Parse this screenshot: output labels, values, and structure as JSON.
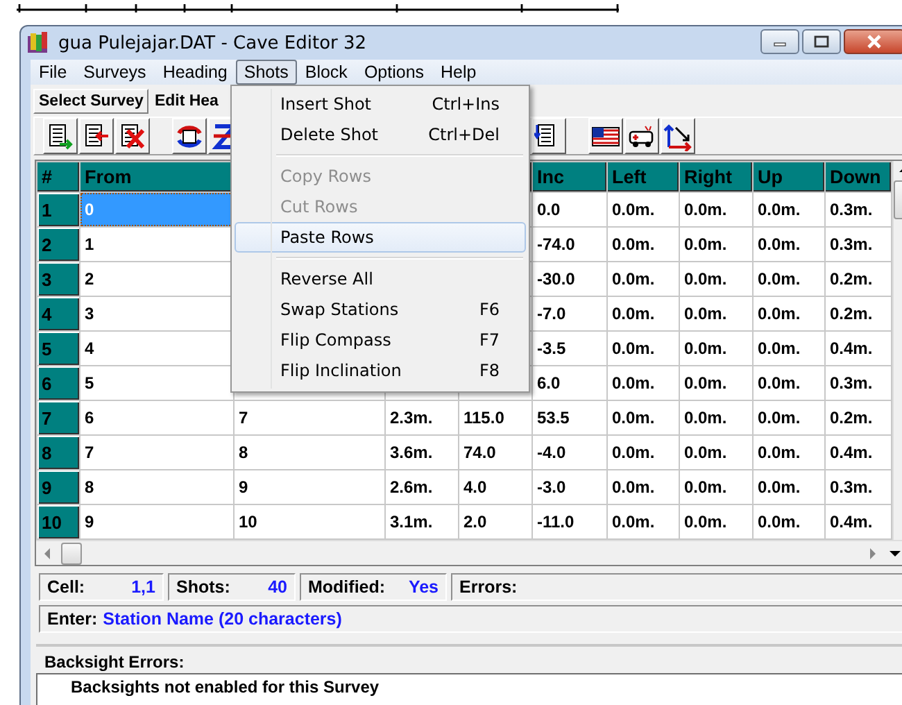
{
  "window": {
    "title": "gua Pulejajar.DAT - Cave Editor 32"
  },
  "menu_bar": [
    {
      "label": "File",
      "selected": false
    },
    {
      "label": "Surveys",
      "selected": false
    },
    {
      "label": "Heading",
      "selected": false
    },
    {
      "label": "Shots",
      "selected": true
    },
    {
      "label": "Block",
      "selected": false
    },
    {
      "label": "Options",
      "selected": false
    },
    {
      "label": "Help",
      "selected": false
    }
  ],
  "shots_menu": [
    {
      "kind": "item",
      "label": "Insert Shot",
      "shortcut": "Ctrl+Ins",
      "disabled": false,
      "selected": false
    },
    {
      "kind": "item",
      "label": "Delete Shot",
      "shortcut": "Ctrl+Del",
      "disabled": false,
      "selected": false
    },
    {
      "kind": "separator"
    },
    {
      "kind": "item",
      "label": "Copy Rows",
      "disabled": true,
      "selected": false
    },
    {
      "kind": "item",
      "label": "Cut Rows",
      "disabled": true,
      "selected": false
    },
    {
      "kind": "item",
      "label": "Paste Rows",
      "disabled": false,
      "selected": true
    },
    {
      "kind": "separator"
    },
    {
      "kind": "item",
      "label": "Reverse All",
      "disabled": false,
      "selected": false
    },
    {
      "kind": "item",
      "label": "Swap Stations",
      "shortcut": "F6",
      "disabled": false,
      "selected": false
    },
    {
      "kind": "item",
      "label": "Flip Compass",
      "shortcut": "F7",
      "disabled": false,
      "selected": false
    },
    {
      "kind": "item",
      "label": "Flip Inclination",
      "shortcut": "F8",
      "disabled": false,
      "selected": false
    }
  ],
  "tabs": [
    {
      "label": "Select Survey",
      "selected": true
    },
    {
      "label": "Edit Hea",
      "selected": false
    }
  ],
  "grid": {
    "columns": [
      {
        "label": "#"
      },
      {
        "label": "From"
      },
      {},
      {},
      {},
      {
        "label": "Inc"
      },
      {
        "label": "Left"
      },
      {
        "label": "Right"
      },
      {
        "label": "Up"
      },
      {
        "label": "Down"
      }
    ],
    "rows": [
      {
        "selected": true,
        "cells": [
          "1",
          "0",
          null,
          null,
          null,
          "0.0",
          "0.0m.",
          "0.0m.",
          "0.0m.",
          "0.3m."
        ]
      },
      {
        "selected": false,
        "cells": [
          "2",
          "1",
          null,
          null,
          null,
          "-74.0",
          "0.0m.",
          "0.0m.",
          "0.0m.",
          "0.3m."
        ]
      },
      {
        "selected": false,
        "cells": [
          "3",
          "2",
          null,
          null,
          null,
          "-30.0",
          "0.0m.",
          "0.0m.",
          "0.0m.",
          "0.2m."
        ]
      },
      {
        "selected": false,
        "cells": [
          "4",
          "3",
          null,
          null,
          null,
          "-7.0",
          "0.0m.",
          "0.0m.",
          "0.0m.",
          "0.2m."
        ]
      },
      {
        "selected": false,
        "cells": [
          "5",
          "4",
          null,
          null,
          null,
          "-3.5",
          "0.0m.",
          "0.0m.",
          "0.0m.",
          "0.4m."
        ]
      },
      {
        "selected": false,
        "cells": [
          "6",
          "5",
          null,
          null,
          null,
          "6.0",
          "0.0m.",
          "0.0m.",
          "0.0m.",
          "0.3m."
        ]
      },
      {
        "selected": false,
        "cells": [
          "7",
          "6",
          "7",
          "2.3m.",
          "115.0",
          "53.5",
          "0.0m.",
          "0.0m.",
          "0.0m.",
          "0.2m."
        ]
      },
      {
        "selected": false,
        "cells": [
          "8",
          "7",
          "8",
          "3.6m.",
          "74.0",
          "-4.0",
          "0.0m.",
          "0.0m.",
          "0.0m.",
          "0.4m."
        ]
      },
      {
        "selected": false,
        "cells": [
          "9",
          "8",
          "9",
          "2.6m.",
          "4.0",
          "-3.0",
          "0.0m.",
          "0.0m.",
          "0.0m.",
          "0.3m."
        ]
      },
      {
        "selected": false,
        "cells": [
          "10",
          "9",
          "10",
          "3.1m.",
          "2.0",
          "-11.0",
          "0.0m.",
          "0.0m.",
          "0.0m.",
          "0.4m."
        ]
      }
    ]
  },
  "status_bar": {
    "cell_label": "Cell:",
    "cell": "1,1",
    "shots_label": "Shots:",
    "shots": "40",
    "modified_label": "Modified:",
    "modified": "Yes",
    "errors_label": "Errors:"
  },
  "prompt": {
    "label": "Enter:",
    "value": "Station Name (20 characters)"
  },
  "backsight": {
    "title": "Backsight Errors:",
    "message": "Backsights not enabled for this Survey"
  }
}
